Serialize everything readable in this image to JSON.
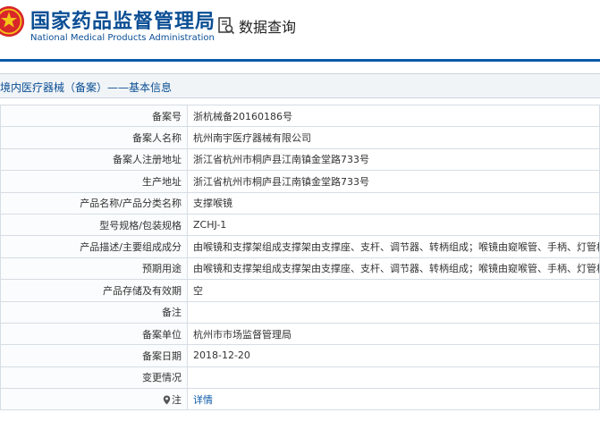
{
  "header": {
    "org_name_cn": "国家药品监督管理局",
    "org_name_en": "National Medical Products Administration",
    "query_label": "数据查询",
    "icons": [
      "emblem-logo",
      "document-search-icon"
    ]
  },
  "breadcrumb": "境内医疗器械（备案）——基本信息",
  "record": [
    {
      "label": "备案号",
      "value": "浙杭械备20160186号"
    },
    {
      "label": "备案人名称",
      "value": "杭州南宇医疗器械有限公司"
    },
    {
      "label": "备案人注册地址",
      "value": "浙江省杭州市桐庐县江南镇金堂路733号"
    },
    {
      "label": "生产地址",
      "value": "浙江省杭州市桐庐县江南镇金堂路733号"
    },
    {
      "label": "产品名称/产品分类名称",
      "value": "支撑喉镜"
    },
    {
      "label": "型号规格/包装规格",
      "value": "ZCHJ-1"
    },
    {
      "label": "产品描述/主要组成成分",
      "value": "由喉镜和支撑架组成支撑架由支撑座、支杆、调节器、转柄组成；喉镜由窥喉管、手柄、灯管槽组成。"
    },
    {
      "label": "预期用途",
      "value": "由喉镜和支撑架组成支撑架由支撑座、支杆、调节器、转柄组成；喉镜由窥喉管、手柄、灯管槽组成。"
    },
    {
      "label": "产品存储及有效期",
      "value": "空"
    },
    {
      "label": "备注",
      "value": ""
    },
    {
      "label": "备案单位",
      "value": "杭州市市场监督管理局"
    },
    {
      "label": "备案日期",
      "value": "2018-12-20"
    },
    {
      "label": "变更情况",
      "value": ""
    }
  ],
  "note": {
    "label": "注",
    "link": "详情"
  }
}
